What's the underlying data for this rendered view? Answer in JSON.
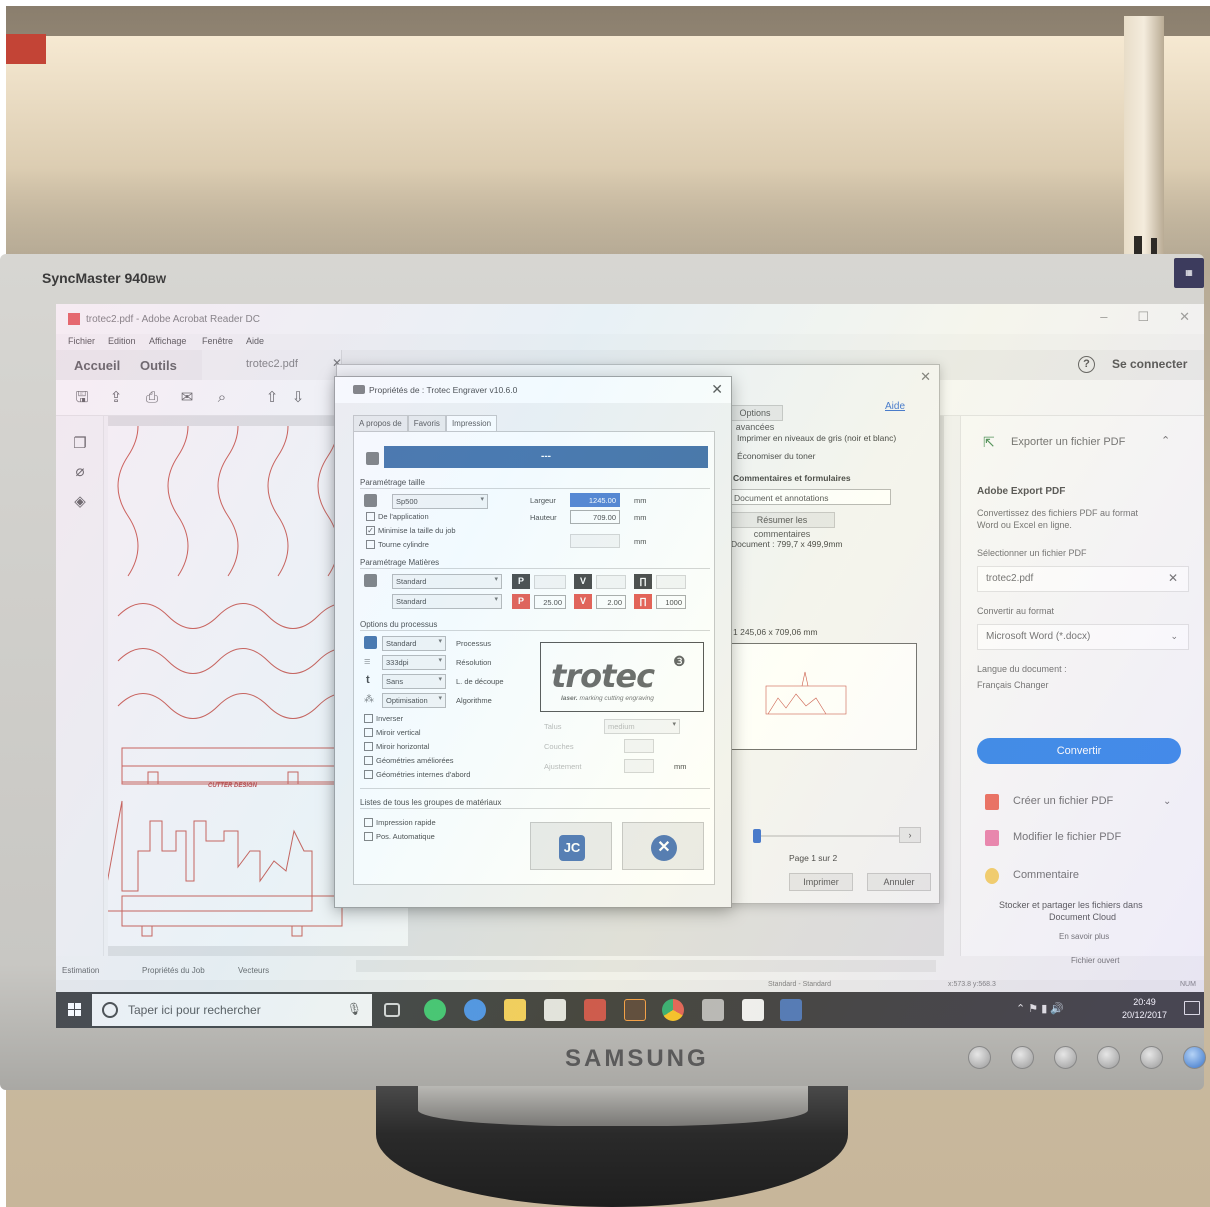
{
  "monitor": {
    "model_main": "SyncMaster 940",
    "model_suffix": "BW",
    "brand": "SAMSUNG"
  },
  "app": {
    "title": "trotec2.pdf - Adobe Acrobat Reader DC",
    "menu": [
      "Fichier",
      "Edition",
      "Affichage",
      "Fenêtre",
      "Aide"
    ],
    "tabs": {
      "home": "Accueil",
      "tools": "Outils",
      "document": "trotec2.pdf"
    },
    "sign_in": "Se connecter"
  },
  "page_label": "CUTTER DESIGN",
  "print_dialog": {
    "advanced_button": "Options avancées",
    "help_link": "Aide",
    "grayscale": "Imprimer en niveaux de gris (noir et blanc)",
    "save_toner": "Économiser du toner",
    "comments_header": "Commentaires et formulaires",
    "comments_select": "Document et annotations",
    "summary_button": "Résumer les commentaires",
    "document_size": "Document : 799,7 x 499,9mm",
    "scale": "1 245,06 x 709,06 mm",
    "page_info": "Page 1 sur 2",
    "print_button": "Imprimer",
    "cancel_button": "Annuler"
  },
  "trotec": {
    "title": "Propriétés de : Trotec Engraver v10.6.0",
    "tabs": [
      "A propos de",
      "Favoris",
      "Impression"
    ],
    "header_value": "---",
    "size_section": "Paramétrage taille",
    "size_preset": "Sp500",
    "width_label": "Largeur",
    "width_value": "1245.00",
    "height_label": "Hauteur",
    "height_value": "709.00",
    "unit": "mm",
    "opt_from_app": "De l'application",
    "opt_minimize": "Minimise la taille du job",
    "opt_rotary": "Tourne cylindre",
    "material_section": "Paramétrage Matières",
    "material_1": "Standard",
    "material_2": "Standard",
    "power_value": "25.00",
    "speed_value": "2.00",
    "freq_value": "1000",
    "process_section": "Options du processus",
    "process_select": "Standard",
    "process_label": "Processus",
    "resolution_select": "333dpi",
    "resolution_label": "Résolution",
    "cutline_select": "Sans",
    "cutline_label": "L. de découpe",
    "algorithm_select": "Optimisation",
    "algorithm_label": "Algorithme",
    "checks": [
      "Inverser",
      "Miroir vertical",
      "Miroir horizontal",
      "Géométries améliorées",
      "Géométries internes d'abord"
    ],
    "taper_label": "Talus",
    "taper_value": "medium",
    "layers_label": "Couches",
    "adjust_label": "Ajustement",
    "logo_text": "trotec",
    "logo_sub_bold": "laser.",
    "logo_sub": " marking cutting engraving",
    "material_groups": "Listes de tous les groupes de matériaux",
    "quick_print": "Impression rapide",
    "auto_pos": "Pos. Automatique"
  },
  "right_panel": {
    "export_title": "Exporter un fichier PDF",
    "export_heading": "Adobe Export PDF",
    "export_desc_1": "Convertissez des fichiers PDF au format",
    "export_desc_2": "Word ou Excel en ligne.",
    "select_file_label": "Sélectionner un fichier PDF",
    "selected_file": "trotec2.pdf",
    "convert_to_label": "Convertir au format",
    "format_value": "Microsoft Word (*.docx)",
    "language_label": "Langue du document :",
    "language_value": "Français Changer",
    "convert_button": "Convertir",
    "create_pdf": "Créer un fichier PDF",
    "edit_pdf": "Modifier le fichier PDF",
    "comment": "Commentaire",
    "cloud_text_1": "Stocker et partager les fichiers dans",
    "cloud_text_2": "Document Cloud",
    "learn_more": "En savoir plus",
    "open_file": "Fichier ouvert"
  },
  "status": {
    "tabs": [
      "Estimation",
      "Propriétés du Job",
      "Vecteurs"
    ],
    "material": "Standard - Standard",
    "coords": "x:573.8   y:568.3",
    "num": "NUM"
  },
  "taskbar": {
    "search_placeholder": "Taper ici pour rechercher",
    "time": "20:49",
    "date": "20/12/2017"
  },
  "colors": {
    "dialog_blue": "#1f5597",
    "acrobat_blue": "#1473e6",
    "power_red": "#e23a2e",
    "design_red": "#c0392b"
  }
}
